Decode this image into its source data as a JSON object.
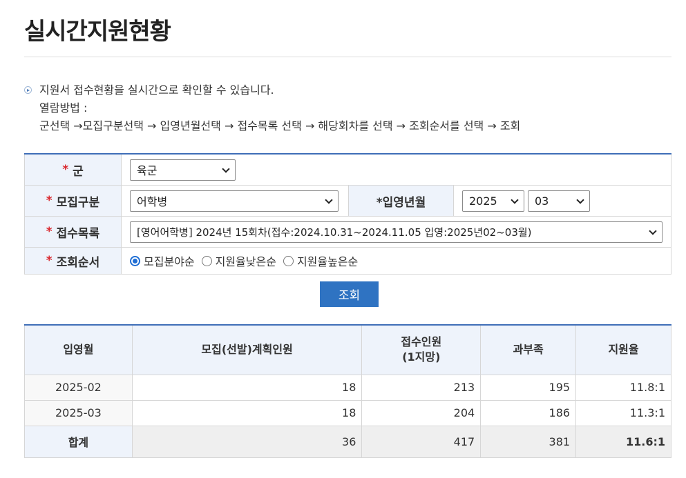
{
  "page": {
    "title": "실시간지원현황"
  },
  "notice": {
    "line1": "지원서 접수현황을 실시간으로 확인할 수 있습니다.",
    "line2": "열람방법 :",
    "line3": "군선택 →모집구분선택 → 입영년월선택 → 접수목록 선택 → 해당회차를 선택 → 조회순서를 선택 → 조회"
  },
  "form": {
    "required_mark": "*",
    "army": {
      "label": "군",
      "value": "육군"
    },
    "category": {
      "label": "모집구분",
      "value": "어학병"
    },
    "enlist": {
      "label": "*입영년월",
      "year": "2025",
      "month": "03"
    },
    "list": {
      "label": "접수목록",
      "value": "[영어어학병] 2024년 15회차(접수:2024.10.31~2024.11.05 입영:2025년02~03월)"
    },
    "order": {
      "label": "조회순서",
      "options": [
        "모집분야순",
        "지원율낮은순",
        "지원율높은순"
      ],
      "selected": "모집분야순"
    },
    "search_label": "조회"
  },
  "results": {
    "headers": [
      "입영월",
      "모집(선발)계획인원",
      "접수인원",
      "(1지망)",
      "과부족",
      "지원율"
    ],
    "rows": [
      [
        "2025-02",
        "18",
        "213",
        "195",
        "11.8:1"
      ],
      [
        "2025-03",
        "18",
        "204",
        "186",
        "11.3:1"
      ]
    ],
    "total": [
      "합계",
      "36",
      "417",
      "381",
      "11.6:1"
    ]
  }
}
